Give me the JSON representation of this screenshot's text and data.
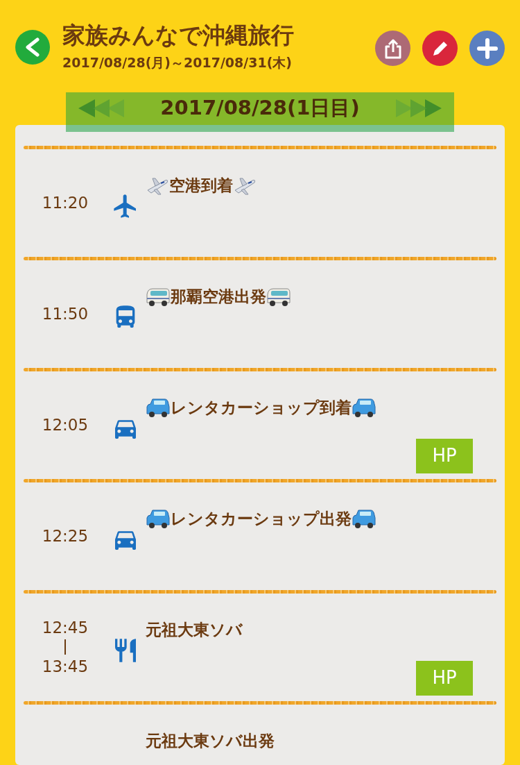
{
  "header": {
    "title": "家族みんなで沖縄旅行",
    "dates": "2017/08/28(月)～2017/08/31(木)"
  },
  "day_banner": {
    "label": "2017/08/28(1日目)"
  },
  "schedule": [
    {
      "kind": "plane",
      "times": [
        "11:20"
      ],
      "title": "空港到着"
    },
    {
      "kind": "bus",
      "times": [
        "11:50"
      ],
      "title": "那覇空港出発"
    },
    {
      "kind": "car",
      "times": [
        "12:05"
      ],
      "title": "レンタカーショップ到着",
      "link": "HP"
    },
    {
      "kind": "car",
      "times": [
        "12:25"
      ],
      "title": "レンタカーショップ出発"
    },
    {
      "kind": "meal",
      "times": [
        "12:45",
        "13:45"
      ],
      "title": "元祖大東ソバ",
      "link": "HP"
    },
    {
      "title": "元祖大東ソバ出発"
    }
  ]
}
